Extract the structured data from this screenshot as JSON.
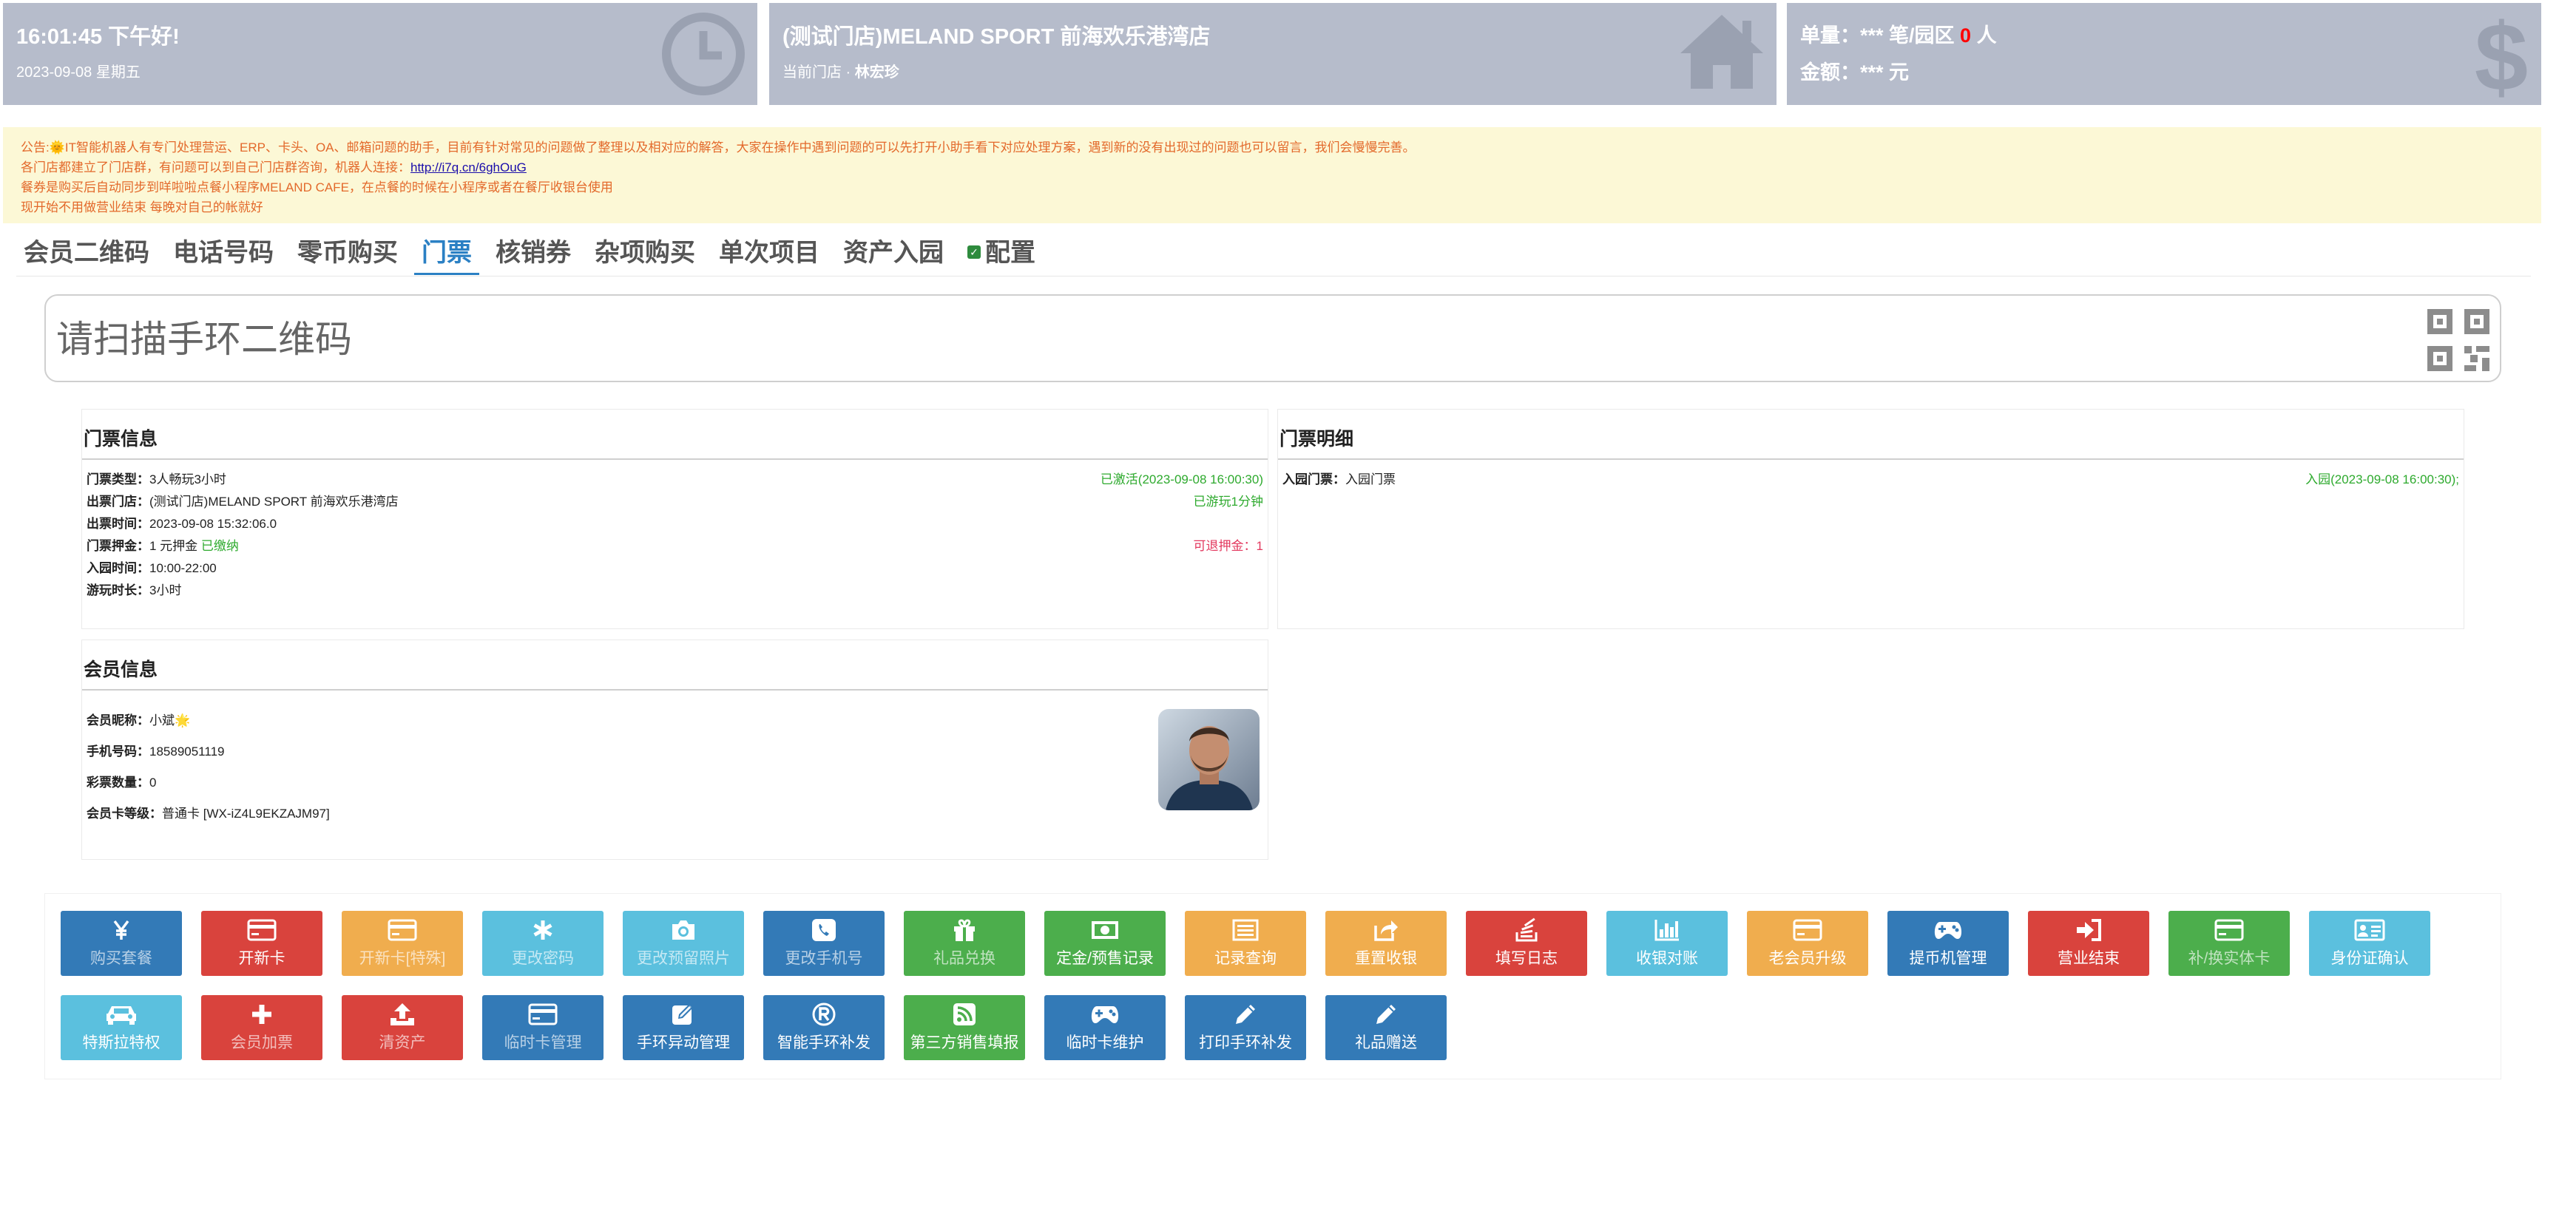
{
  "header": {
    "time": "16:01:45 下午好!",
    "date": "2023-09-08 星期五",
    "store_name": "(测试门店)MELAND SPORT 前海欢乐港湾店",
    "current_store_label": "当前门店 ·",
    "current_user": "林宏珍",
    "stats_orders_prefix": "单量：*** 笔/园区",
    "stats_orders_count": "0",
    "stats_orders_suffix": "人",
    "stats_amount": "金额：*** 元"
  },
  "notice": {
    "line1": "公告:🌞IT智能机器人有专门处理营运、ERP、卡头、OA、邮箱问题的助手，目前有针对常见的问题做了整理以及相对应的解答，大家在操作中遇到问题的可以先打开小助手看下对应处理方案，遇到新的没有出现过的问题也可以留言，我们会慢慢完善。",
    "line2_prefix": "各门店都建立了门店群，有问题可以到自己门店群咨询，机器人连接：",
    "line2_link": "http://i7q.cn/6ghOuG",
    "line3": "餐券是购买后自动同步到咩啦啦点餐小程序MELAND CAFE，在点餐的时候在小程序或者在餐厅收银台使用",
    "line4": "现开始不用做营业结束 每晚对自己的帐就好"
  },
  "tabs": [
    {
      "label": "会员二维码"
    },
    {
      "label": "电话号码"
    },
    {
      "label": "零币购买"
    },
    {
      "label": "门票"
    },
    {
      "label": "核销券"
    },
    {
      "label": "杂项购买"
    },
    {
      "label": "单次项目"
    },
    {
      "label": "资产入园"
    },
    {
      "label": "配置"
    }
  ],
  "scan": {
    "placeholder": "请扫描手环二维码"
  },
  "ticket_info": {
    "title": "门票信息",
    "type_label": "门票类型：",
    "type_value": "3人畅玩3小时",
    "status": "已激活(2023-09-08 16:00:30)",
    "store_label": "出票门店：",
    "store_value": "(测试门店)MELAND SPORT 前海欢乐港湾店",
    "played": "已游玩1分钟",
    "issue_time_label": "出票时间：",
    "issue_time_value": "2023-09-08 15:32:06.0",
    "deposit_label": "门票押金：",
    "deposit_value": "1 元押金",
    "deposit_status": "已缴纳",
    "refundable": "可退押金：1",
    "entry_time_label": "入园时间：",
    "entry_time_value": "10:00-22:00",
    "duration_label": "游玩时长：",
    "duration_value": "3小时"
  },
  "ticket_detail": {
    "title": "门票明细",
    "entry_label": "入园门票：",
    "entry_value": "入园门票",
    "entry_status": "入园(2023-09-08 16:00:30);"
  },
  "member_info": {
    "title": "会员信息",
    "nickname_label": "会员昵称：",
    "nickname_value": "小斌🌟",
    "phone_label": "手机号码：",
    "phone_value": "18589051119",
    "lottery_label": "彩票数量：",
    "lottery_value": "0",
    "level_label": "会员卡等级：",
    "level_value": "普通卡 [WX-iZ4L9EKZAJM97]"
  },
  "actions": [
    {
      "label": "购买套餐",
      "icon": "yen-icon",
      "color": "#337ab7",
      "dim": true
    },
    {
      "label": "开新卡",
      "icon": "card-icon",
      "color": "#d9433d",
      "dim": false
    },
    {
      "label": "开新卡[特殊]",
      "icon": "card-icon",
      "color": "#f0ad4e",
      "dim": true
    },
    {
      "label": "更改密码",
      "icon": "asterisk-icon",
      "color": "#5bc0de",
      "dim": true
    },
    {
      "label": "更改预留照片",
      "icon": "camera-icon",
      "color": "#5bc0de",
      "dim": true
    },
    {
      "label": "更改手机号",
      "icon": "phone-icon",
      "color": "#337ab7",
      "dim": true
    },
    {
      "label": "礼品兑换",
      "icon": "gift-icon",
      "color": "#4cae4c",
      "dim": true
    },
    {
      "label": "定金/预售记录",
      "icon": "money-icon",
      "color": "#4cae4c",
      "dim": false
    },
    {
      "label": "记录查询",
      "icon": "list-icon",
      "color": "#f0ad4e",
      "dim": false
    },
    {
      "label": "重置收银",
      "icon": "share-icon",
      "color": "#f0ad4e",
      "dim": false
    },
    {
      "label": "填写日志",
      "icon": "stack-icon",
      "color": "#d9433d",
      "dim": false
    },
    {
      "label": "收银对账",
      "icon": "bar-chart-icon",
      "color": "#5bc0de",
      "dim": false
    },
    {
      "label": "老会员升级",
      "icon": "card-icon",
      "color": "#f0ad4e",
      "dim": false
    },
    {
      "label": "提币机管理",
      "icon": "gamepad-icon",
      "color": "#337ab7",
      "dim": false
    },
    {
      "label": "营业结束",
      "icon": "sign-in-icon",
      "color": "#d9433d",
      "dim": false
    },
    {
      "label": "补/换实体卡",
      "icon": "card-icon",
      "color": "#4cae4c",
      "dim": true
    },
    {
      "label": "身份证确认",
      "icon": "id-card-icon",
      "color": "#5bc0de",
      "dim": false
    },
    {
      "label": "特斯拉特权",
      "icon": "car-icon",
      "color": "#5bc0de",
      "dim": false
    },
    {
      "label": "会员加票",
      "icon": "plus-icon",
      "color": "#d9433d",
      "dim": true
    },
    {
      "label": "清资产",
      "icon": "upload-icon",
      "color": "#d9433d",
      "dim": true
    },
    {
      "label": "临时卡管理",
      "icon": "card-icon",
      "color": "#337ab7",
      "dim": true
    },
    {
      "label": "手环异动管理",
      "icon": "edit-icon",
      "color": "#337ab7",
      "dim": false
    },
    {
      "label": "智能手环补发",
      "icon": "registered-icon",
      "color": "#337ab7",
      "dim": false
    },
    {
      "label": "第三方销售填报",
      "icon": "rss-icon",
      "color": "#4cae4c",
      "dim": false
    },
    {
      "label": "临时卡维护",
      "icon": "gamepad-icon",
      "color": "#337ab7",
      "dim": false
    },
    {
      "label": "打印手环补发",
      "icon": "pencil-icon",
      "color": "#337ab7",
      "dim": false
    },
    {
      "label": "礼品赠送",
      "icon": "pencil-icon",
      "color": "#337ab7",
      "dim": false
    }
  ]
}
